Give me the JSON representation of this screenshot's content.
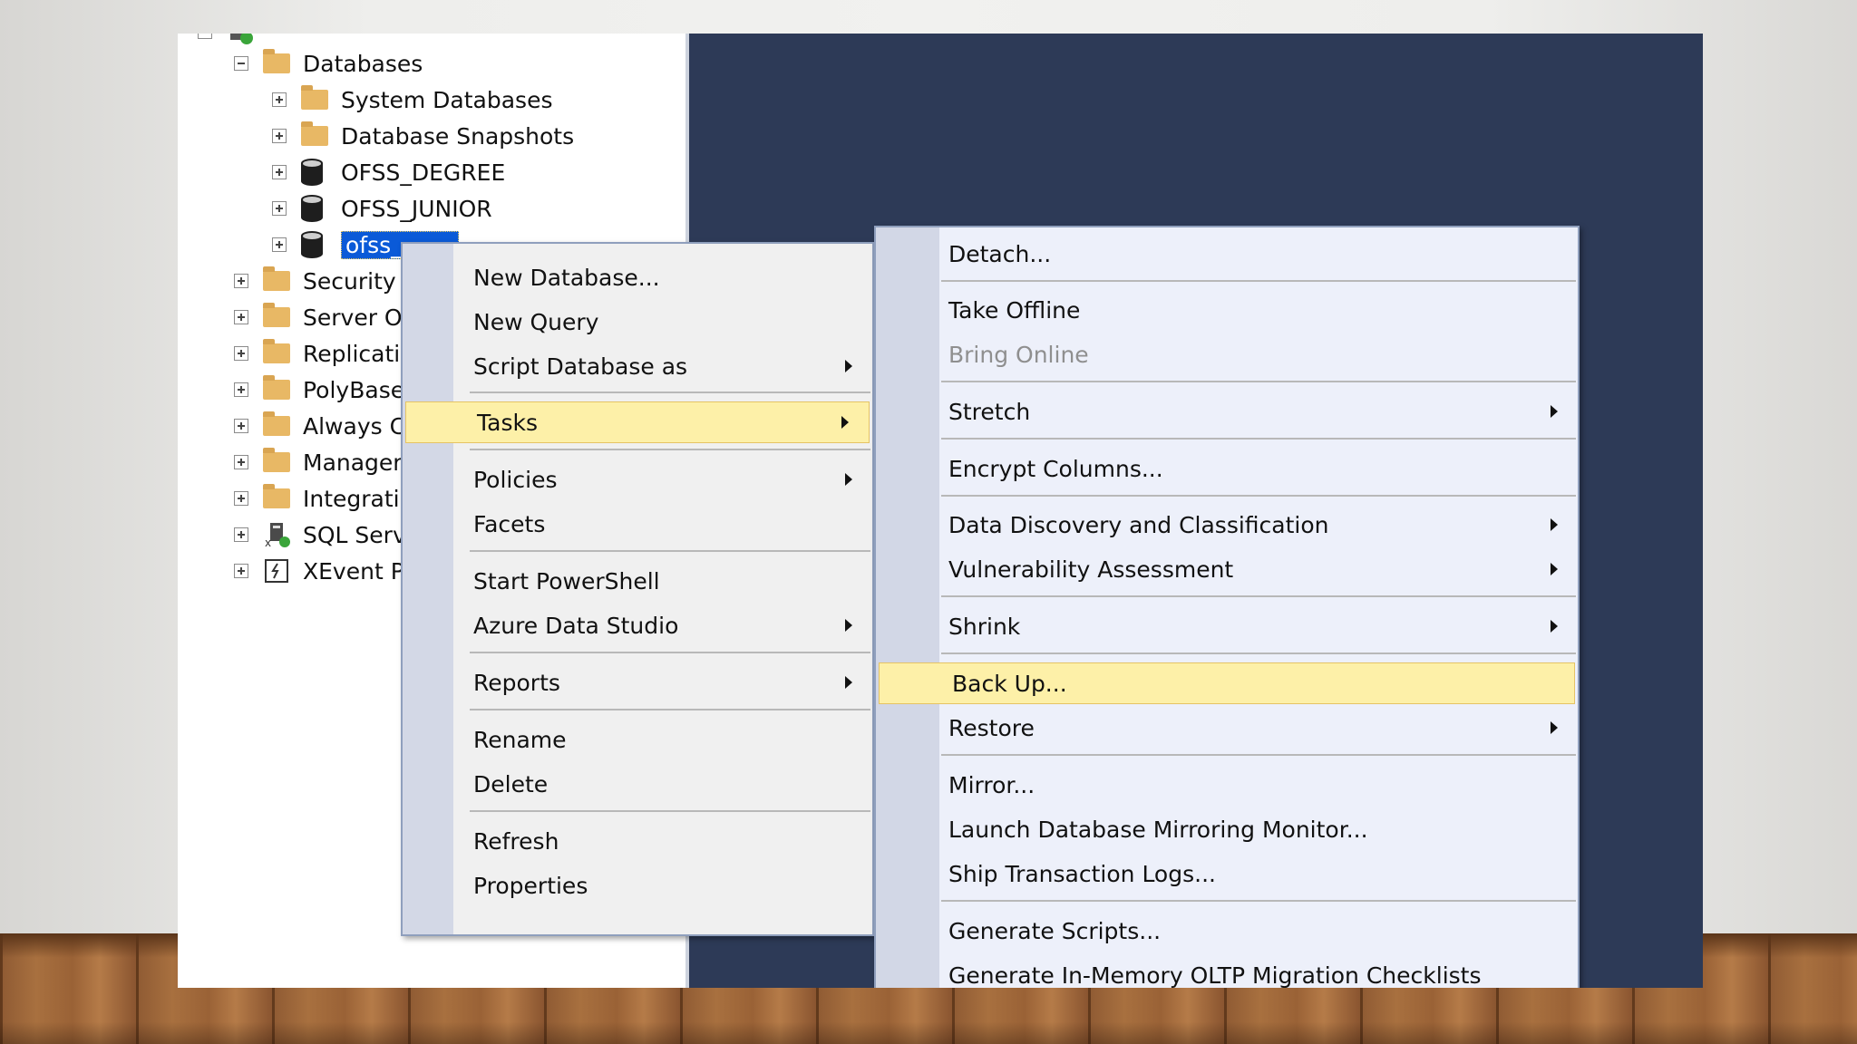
{
  "tree": {
    "server_label": "",
    "items": [
      {
        "label": "Databases",
        "icon": "folder-icon",
        "expander": "minus"
      },
      {
        "label": "System Databases",
        "icon": "folder-icon",
        "expander": "plus"
      },
      {
        "label": "Database Snapshots",
        "icon": "folder-icon",
        "expander": "plus"
      },
      {
        "label": "OFSS_DEGREE",
        "icon": "database-icon",
        "expander": "plus"
      },
      {
        "label": "OFSS_JUNIOR",
        "icon": "database-icon",
        "expander": "plus"
      },
      {
        "label": "ofss_",
        "icon": "database-icon",
        "expander": "plus",
        "selected": true
      },
      {
        "label": "Security",
        "icon": "folder-icon",
        "expander": "plus"
      },
      {
        "label": "Server Ol",
        "icon": "folder-icon",
        "expander": "plus"
      },
      {
        "label": "Replicati",
        "icon": "folder-icon",
        "expander": "plus"
      },
      {
        "label": "PolyBase",
        "icon": "folder-icon",
        "expander": "plus"
      },
      {
        "label": "Always C",
        "icon": "folder-icon",
        "expander": "plus"
      },
      {
        "label": "Manager",
        "icon": "folder-icon",
        "expander": "plus"
      },
      {
        "label": "Integratic",
        "icon": "folder-icon",
        "expander": "plus"
      },
      {
        "label": "SQL Serv",
        "icon": "sql-agent-icon",
        "expander": "plus"
      },
      {
        "label": "XEvent P",
        "icon": "xevent-icon",
        "expander": "plus"
      }
    ]
  },
  "context_menu": {
    "items": [
      {
        "label": "New Database...",
        "submenu": false
      },
      {
        "label": "New Query",
        "submenu": false
      },
      {
        "label": "Script Database as",
        "submenu": true
      },
      {
        "label": "Tasks",
        "submenu": true,
        "highlighted": true
      },
      {
        "label": "Policies",
        "submenu": true
      },
      {
        "label": "Facets",
        "submenu": false
      },
      {
        "label": "Start PowerShell",
        "submenu": false
      },
      {
        "label": "Azure Data Studio",
        "submenu": true
      },
      {
        "label": "Reports",
        "submenu": true
      },
      {
        "label": "Rename",
        "submenu": false
      },
      {
        "label": "Delete",
        "submenu": false
      },
      {
        "label": "Refresh",
        "submenu": false
      },
      {
        "label": "Properties",
        "submenu": false
      }
    ]
  },
  "tasks_menu": {
    "items": [
      {
        "label": "Detach...",
        "submenu": false
      },
      {
        "label": "Take Offline",
        "submenu": false
      },
      {
        "label": "Bring Online",
        "submenu": false,
        "disabled": true
      },
      {
        "label": "Stretch",
        "submenu": true
      },
      {
        "label": "Encrypt Columns...",
        "submenu": false
      },
      {
        "label": "Data Discovery and Classification",
        "submenu": true
      },
      {
        "label": "Vulnerability Assessment",
        "submenu": true
      },
      {
        "label": "Shrink",
        "submenu": true
      },
      {
        "label": "Back Up...",
        "submenu": false,
        "highlighted": true
      },
      {
        "label": "Restore",
        "submenu": true
      },
      {
        "label": "Mirror...",
        "submenu": false
      },
      {
        "label": "Launch Database Mirroring Monitor...",
        "submenu": false
      },
      {
        "label": "Ship Transaction Logs...",
        "submenu": false
      },
      {
        "label": "Generate Scripts...",
        "submenu": false
      },
      {
        "label": "Generate In-Memory OLTP Migration Checklists",
        "submenu": false
      }
    ]
  },
  "colors": {
    "highlight": "#fdf0a8",
    "selection": "#0a5ad8",
    "background_panel": "#2d3a57"
  }
}
